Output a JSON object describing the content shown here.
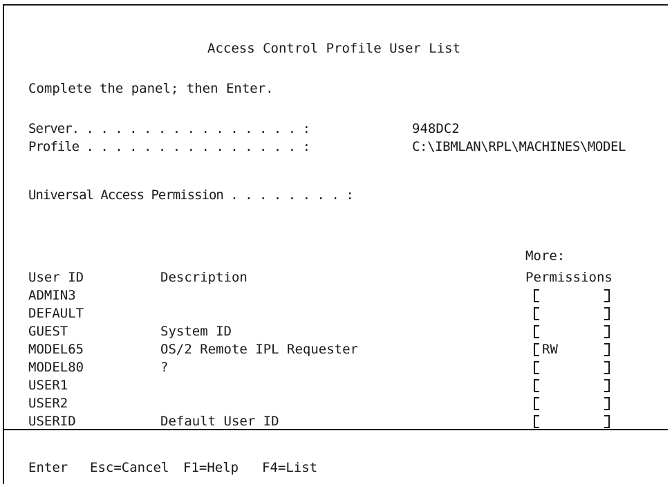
{
  "panel": {
    "title": "Access Control Profile User List",
    "instruction": "Complete the panel; then Enter."
  },
  "fields": {
    "server_label": "Server. . . . . . . . . . . . . . . . :",
    "server_value": "948DC2",
    "profile_label": "Profile . . . . . . . . . . . . . . . :",
    "profile_value": "C:\\IBMLAN\\RPL\\MACHINES\\MODEL",
    "uap_label": "Universal Access Permission . . . . . . . . :"
  },
  "table": {
    "more_label": "More:",
    "headers": {
      "user_id": "User ID",
      "description": "Description",
      "permissions": "Permissions"
    },
    "rows": [
      {
        "user_id": "ADMIN3",
        "description": "",
        "permission": ""
      },
      {
        "user_id": "DEFAULT",
        "description": "",
        "permission": ""
      },
      {
        "user_id": "GUEST",
        "description": "System ID",
        "permission": ""
      },
      {
        "user_id": "MODEL65",
        "description": "OS/2 Remote IPL Requester",
        "permission": "RW"
      },
      {
        "user_id": "MODEL80",
        "description": "?",
        "permission": ""
      },
      {
        "user_id": "USER1",
        "description": "",
        "permission": ""
      },
      {
        "user_id": "USER2",
        "description": "",
        "permission": ""
      },
      {
        "user_id": "USERID",
        "description": "Default User ID",
        "permission": ""
      }
    ]
  },
  "footer": {
    "keys": [
      {
        "label": "Enter"
      },
      {
        "label": "Esc=Cancel"
      },
      {
        "label": "F1=Help"
      },
      {
        "label": "F4=List"
      }
    ]
  }
}
